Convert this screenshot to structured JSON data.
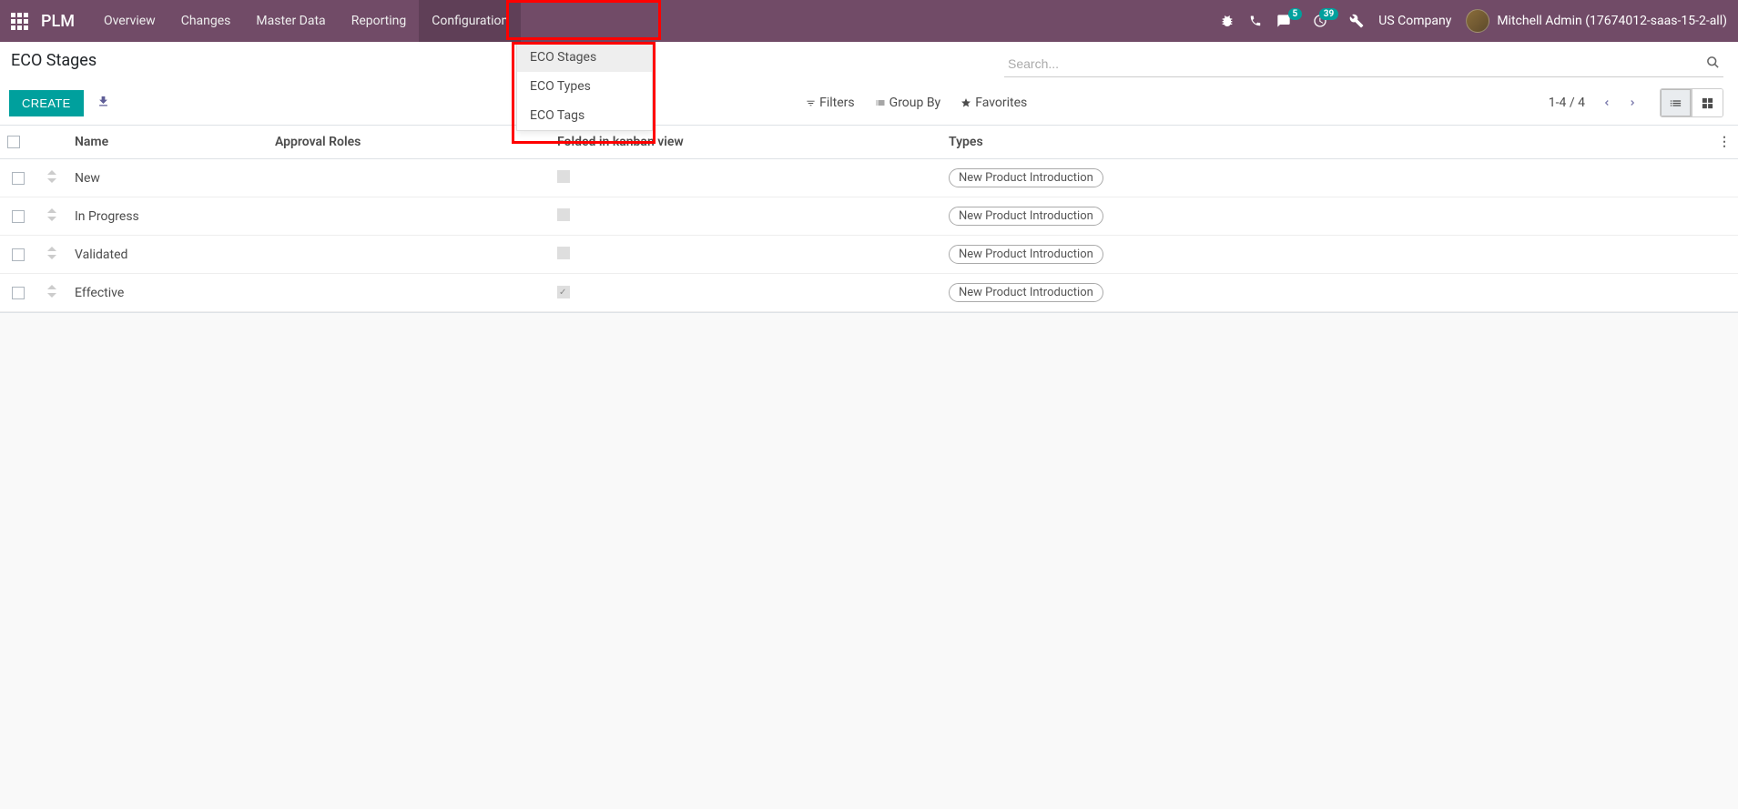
{
  "navbar": {
    "brand": "PLM",
    "menu": [
      "Overview",
      "Changes",
      "Master Data",
      "Reporting",
      "Configuration"
    ],
    "active_menu_index": 4,
    "message_badge": "5",
    "activity_badge": "39",
    "company": "US Company",
    "user": "Mitchell Admin (17674012-saas-15-2-all)"
  },
  "dropdown": {
    "items": [
      "ECO Stages",
      "ECO Types",
      "ECO Tags"
    ],
    "selected_index": 0
  },
  "control_panel": {
    "title": "ECO Stages",
    "create_label": "CREATE",
    "search_placeholder": "Search...",
    "filters_label": "Filters",
    "groupby_label": "Group By",
    "favorites_label": "Favorites",
    "pager": "1-4 / 4"
  },
  "table": {
    "headers": {
      "name": "Name",
      "approval": "Approval Roles",
      "folded": "Folded in kanban view",
      "types": "Types"
    },
    "rows": [
      {
        "name": "New",
        "approval": "",
        "folded": false,
        "type_tag": "New Product Introduction"
      },
      {
        "name": "In Progress",
        "approval": "",
        "folded": false,
        "type_tag": "New Product Introduction"
      },
      {
        "name": "Validated",
        "approval": "",
        "folded": false,
        "type_tag": "New Product Introduction"
      },
      {
        "name": "Effective",
        "approval": "",
        "folded": true,
        "type_tag": "New Product Introduction"
      }
    ]
  }
}
